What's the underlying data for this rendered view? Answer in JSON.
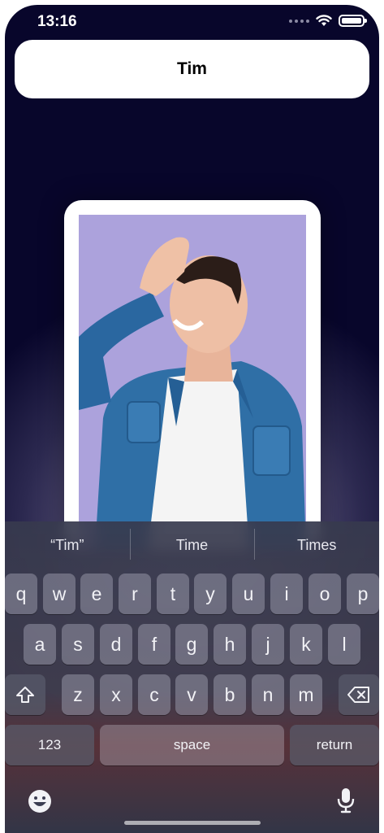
{
  "status_bar": {
    "time": "13:16"
  },
  "header": {
    "name": "Tim"
  },
  "photo": {
    "description_icon": "person-photo"
  },
  "keyboard": {
    "suggestions": [
      "“Tim”",
      "Time",
      "Times"
    ],
    "row1": [
      "q",
      "w",
      "e",
      "r",
      "t",
      "y",
      "u",
      "i",
      "o",
      "p"
    ],
    "row2": [
      "a",
      "s",
      "d",
      "f",
      "g",
      "h",
      "j",
      "k",
      "l"
    ],
    "row3": [
      "z",
      "x",
      "c",
      "v",
      "b",
      "n",
      "m"
    ],
    "numbers_label": "123",
    "space_label": "space",
    "return_label": "return"
  },
  "colors": {
    "background_top": "#08062b",
    "photo_bg": "#a99ed8",
    "key_bg": "#8f8fa0"
  }
}
